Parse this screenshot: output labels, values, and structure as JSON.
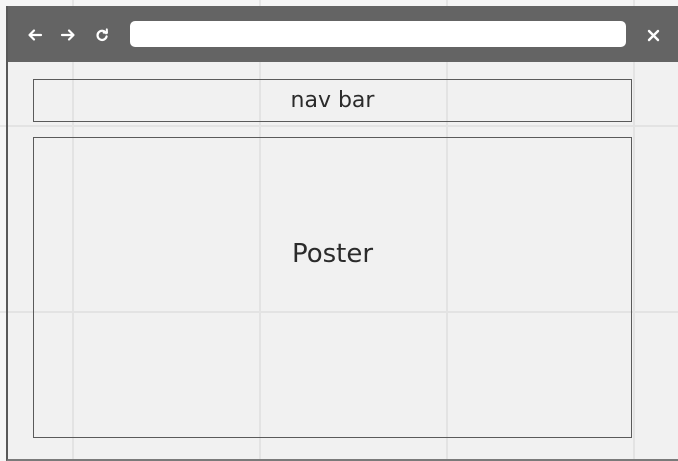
{
  "window": {
    "chrome_color": "#646464",
    "icons": {
      "back": "arrow-left-icon",
      "forward": "arrow-right-icon",
      "reload": "reload-icon",
      "close": "close-icon"
    }
  },
  "address_bar": {
    "value": "",
    "placeholder": ""
  },
  "page": {
    "nav_label": "nav bar",
    "poster_label": "Poster"
  }
}
